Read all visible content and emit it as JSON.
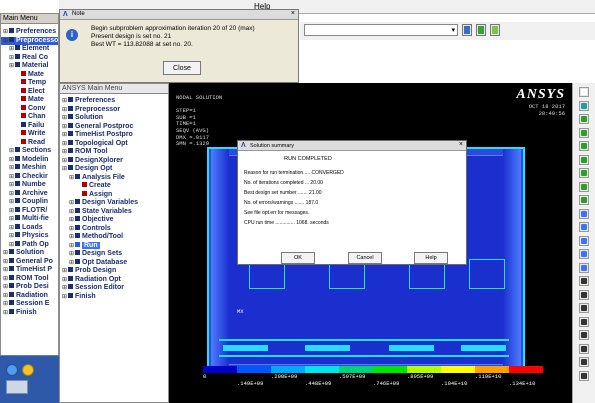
{
  "main_menu": {
    "title": "Main Menu"
  },
  "left_tree": [
    {
      "label": "Preferences",
      "color": "#1a2e6b",
      "indent": 0
    },
    {
      "label": "Preprocessor",
      "color": "#1a2e6b",
      "indent": 0,
      "selected": true
    },
    {
      "label": "Element",
      "color": "#1a2e6b",
      "indent": 1
    },
    {
      "label": "Real Co",
      "color": "#1a2e6b",
      "indent": 1
    },
    {
      "label": "Material",
      "color": "#1a2e6b",
      "indent": 1
    },
    {
      "label": "Mate",
      "color": "#b30000",
      "indent": 2
    },
    {
      "label": "Temp",
      "color": "#b30000",
      "indent": 2
    },
    {
      "label": "Elect",
      "color": "#b30000",
      "indent": 2
    },
    {
      "label": "Mate",
      "color": "#b30000",
      "indent": 2
    },
    {
      "label": "Conv",
      "color": "#b30000",
      "indent": 2
    },
    {
      "label": "Chan",
      "color": "#b30000",
      "indent": 2
    },
    {
      "label": "Failu",
      "color": "#1a2e6b",
      "indent": 2
    },
    {
      "label": "Write",
      "color": "#b30000",
      "indent": 2
    },
    {
      "label": "Read",
      "color": "#b30000",
      "indent": 2
    },
    {
      "label": "Sections",
      "color": "#1a2e6b",
      "indent": 1
    },
    {
      "label": "Modelin",
      "color": "#1a2e6b",
      "indent": 1
    },
    {
      "label": "Meshin",
      "color": "#1a2e6b",
      "indent": 1
    },
    {
      "label": "Checkir",
      "color": "#1a2e6b",
      "indent": 1
    },
    {
      "label": "Numbe",
      "color": "#1a2e6b",
      "indent": 1
    },
    {
      "label": "Archive",
      "color": "#1a2e6b",
      "indent": 1
    },
    {
      "label": "Couplin",
      "color": "#1a2e6b",
      "indent": 1
    },
    {
      "label": "FLOTR/",
      "color": "#1a2e6b",
      "indent": 1
    },
    {
      "label": "Multi-fie",
      "color": "#1a2e6b",
      "indent": 1
    },
    {
      "label": "Loads",
      "color": "#1a2e6b",
      "indent": 1
    },
    {
      "label": "Physics",
      "color": "#1a2e6b",
      "indent": 1
    },
    {
      "label": "Path Op",
      "color": "#1a2e6b",
      "indent": 1
    },
    {
      "label": "Solution",
      "color": "#1a2e6b",
      "indent": 0
    },
    {
      "label": "General Po",
      "color": "#1a2e6b",
      "indent": 0
    },
    {
      "label": "TimeHist P",
      "color": "#1a2e6b",
      "indent": 0
    },
    {
      "label": "ROM Tool",
      "color": "#1a2e6b",
      "indent": 0
    },
    {
      "label": "Prob Desi",
      "color": "#1a2e6b",
      "indent": 0
    },
    {
      "label": "Radiation",
      "color": "#1a2e6b",
      "indent": 0
    },
    {
      "label": "Session E",
      "color": "#1a2e6b",
      "indent": 0
    },
    {
      "label": "Finish",
      "color": "#1a2e6b",
      "indent": 0
    }
  ],
  "mid_tree_title": "ANSYS Main Menu",
  "mid_tree": [
    {
      "label": "Preferences",
      "color": "#1a2e6b",
      "indent": 0
    },
    {
      "label": "Preprocessor",
      "color": "#1a2e6b",
      "indent": 0
    },
    {
      "label": "Solution",
      "color": "#1a2e6b",
      "indent": 0
    },
    {
      "label": "General Postproc",
      "color": "#1a2e6b",
      "indent": 0
    },
    {
      "label": "TimeHist Postpro",
      "color": "#1a2e6b",
      "indent": 0
    },
    {
      "label": "Topological Opt",
      "color": "#1a2e6b",
      "indent": 0
    },
    {
      "label": "ROM Tool",
      "color": "#1a2e6b",
      "indent": 0
    },
    {
      "label": "DesignXplorer",
      "color": "#1a2e6b",
      "indent": 0
    },
    {
      "label": "Design Opt",
      "color": "#1a2e6b",
      "indent": 0
    },
    {
      "label": "Analysis File",
      "color": "#1a2e6b",
      "indent": 1
    },
    {
      "label": "Create",
      "color": "#b30000",
      "indent": 2
    },
    {
      "label": "Assign",
      "color": "#b30000",
      "indent": 2
    },
    {
      "label": "Design Variables",
      "color": "#1a2e6b",
      "indent": 1
    },
    {
      "label": "State Variables",
      "color": "#1a2e6b",
      "indent": 1
    },
    {
      "label": "Objective",
      "color": "#1a2e6b",
      "indent": 1
    },
    {
      "label": "Controls",
      "color": "#1a2e6b",
      "indent": 1
    },
    {
      "label": "Method/Tool",
      "color": "#1a2e6b",
      "indent": 1
    },
    {
      "label": "Run",
      "color": "#ffffff",
      "indent": 1,
      "highlight": true
    },
    {
      "label": "Design Sets",
      "color": "#1a2e6b",
      "indent": 1
    },
    {
      "label": "Opt Database",
      "color": "#1a2e6b",
      "indent": 1
    },
    {
      "label": "Prob Design",
      "color": "#1a2e6b",
      "indent": 0
    },
    {
      "label": "Radiation Opt",
      "color": "#1a2e6b",
      "indent": 0
    },
    {
      "label": "Session Editor",
      "color": "#1a2e6b",
      "indent": 0
    },
    {
      "label": "Finish",
      "color": "#1a2e6b",
      "indent": 0
    }
  ],
  "top_menu": {
    "help": "Help"
  },
  "note": {
    "title": "Note",
    "line1": "Begin subproblem approximation iteration 20 of 20 (max)",
    "line2": "Present design is set no.  21",
    "line3": "Best WT = 113.82088 at set no.  20.",
    "close": "Close"
  },
  "viewport": {
    "title_block": [
      "NODAL SOLUTION",
      "",
      "STEP=1",
      "SUB =1",
      "TIME=1",
      "SEQV     (AVG)",
      "DMX =.0117",
      "SMN =.1329"
    ],
    "brand": "ANSYS",
    "date": "OCT 18 2017",
    "time": "20:49:56",
    "mx_label": "MX"
  },
  "summary": {
    "title": "Solution summary",
    "status": "RUN COMPLETED",
    "rows": [
      "Reason for run termination..... CONVERGED",
      "No. of iterations completed ... 20.00",
      "Best design set number .......  21.00",
      "No. of errors/warnings .......  187.0",
      " See file opt.err for messages.",
      "CPU run time ..............  1068. seconds"
    ],
    "ok": "OK",
    "cancel": "Cancel",
    "help": "Help"
  },
  "legend": {
    "top_labels": [
      "0",
      ".298E+09",
      ".597E+09",
      ".895E+09",
      ".119E+10"
    ],
    "bottom_labels": [
      ".149E+09",
      ".448E+09",
      ".746E+09",
      ".104E+10",
      ".134E+10"
    ],
    "colors": [
      "#0000c8",
      "#0055ff",
      "#00a8ff",
      "#00e5e5",
      "#00d27a",
      "#00e600",
      "#b4ff00",
      "#ffff00",
      "#ffa000",
      "#ff0000"
    ]
  },
  "colors": {
    "model_blue": "#2b4bdc",
    "model_light": "#4d7cff",
    "model_cyan": "#24e0ff"
  }
}
